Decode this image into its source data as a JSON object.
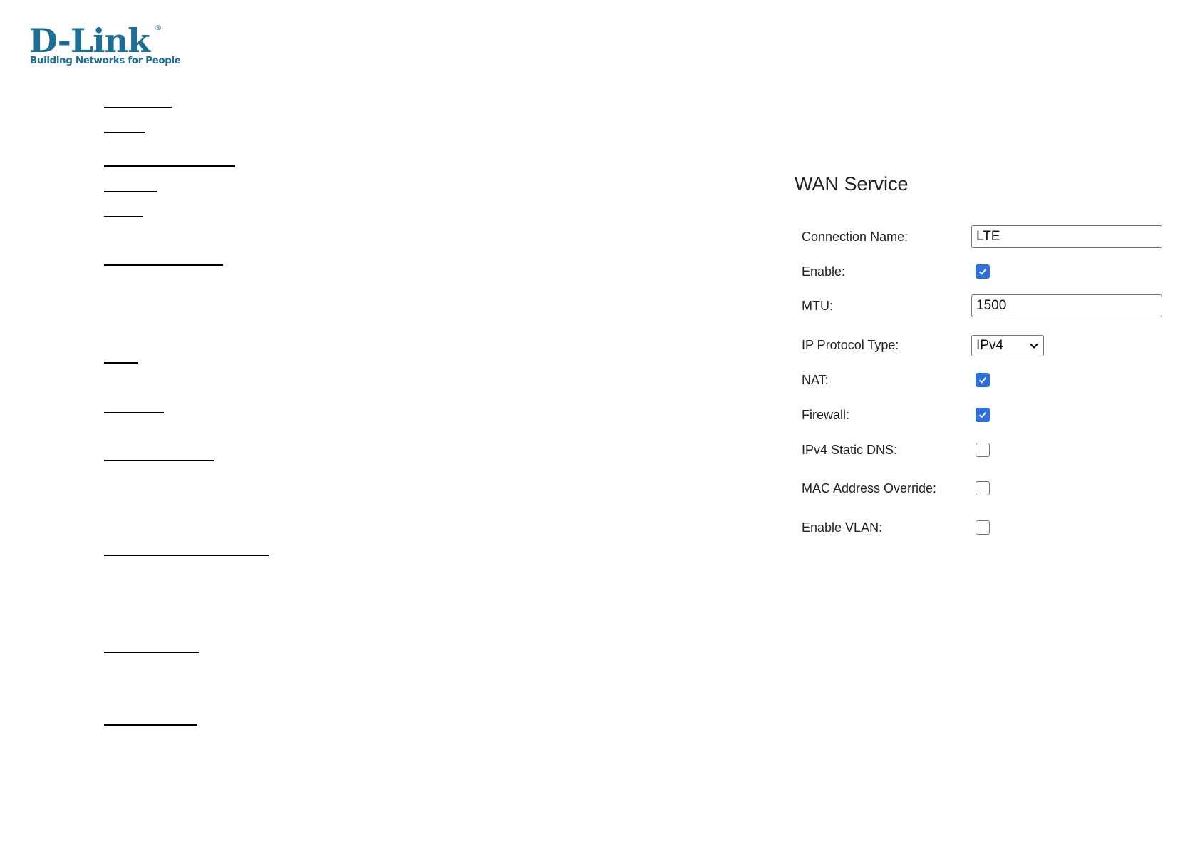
{
  "logo": {
    "brand": "D-Link",
    "registered_mark": "®",
    "tagline": "Building Networks for People"
  },
  "nav": {
    "items": [
      {
        "label": ""
      },
      {
        "label": ""
      },
      {
        "label": ""
      },
      {
        "label": ""
      },
      {
        "label": ""
      },
      {
        "label": ""
      },
      {
        "label": ""
      },
      {
        "label": ""
      },
      {
        "label": ""
      },
      {
        "label": ""
      },
      {
        "label": ""
      },
      {
        "label": ""
      }
    ]
  },
  "wan_service": {
    "title": "WAN Service",
    "connection_name": {
      "label": "Connection Name:",
      "value": "LTE"
    },
    "enable": {
      "label": "Enable:",
      "checked": true
    },
    "mtu": {
      "label": "MTU:",
      "value": "1500"
    },
    "ip_protocol_type": {
      "label": "IP Protocol Type:",
      "value": "IPv4"
    },
    "nat": {
      "label": "NAT:",
      "checked": true
    },
    "firewall": {
      "label": "Firewall:",
      "checked": true
    },
    "ipv4_static_dns": {
      "label": "IPv4 Static DNS:",
      "checked": false
    },
    "mac_address_override": {
      "label": "MAC Address Override:",
      "checked": false
    },
    "enable_vlan": {
      "label": "Enable VLAN:",
      "checked": false
    }
  },
  "colors": {
    "brand": "#1b6e96",
    "checkbox_checked": "#2d6fe0",
    "text": "#222222"
  }
}
